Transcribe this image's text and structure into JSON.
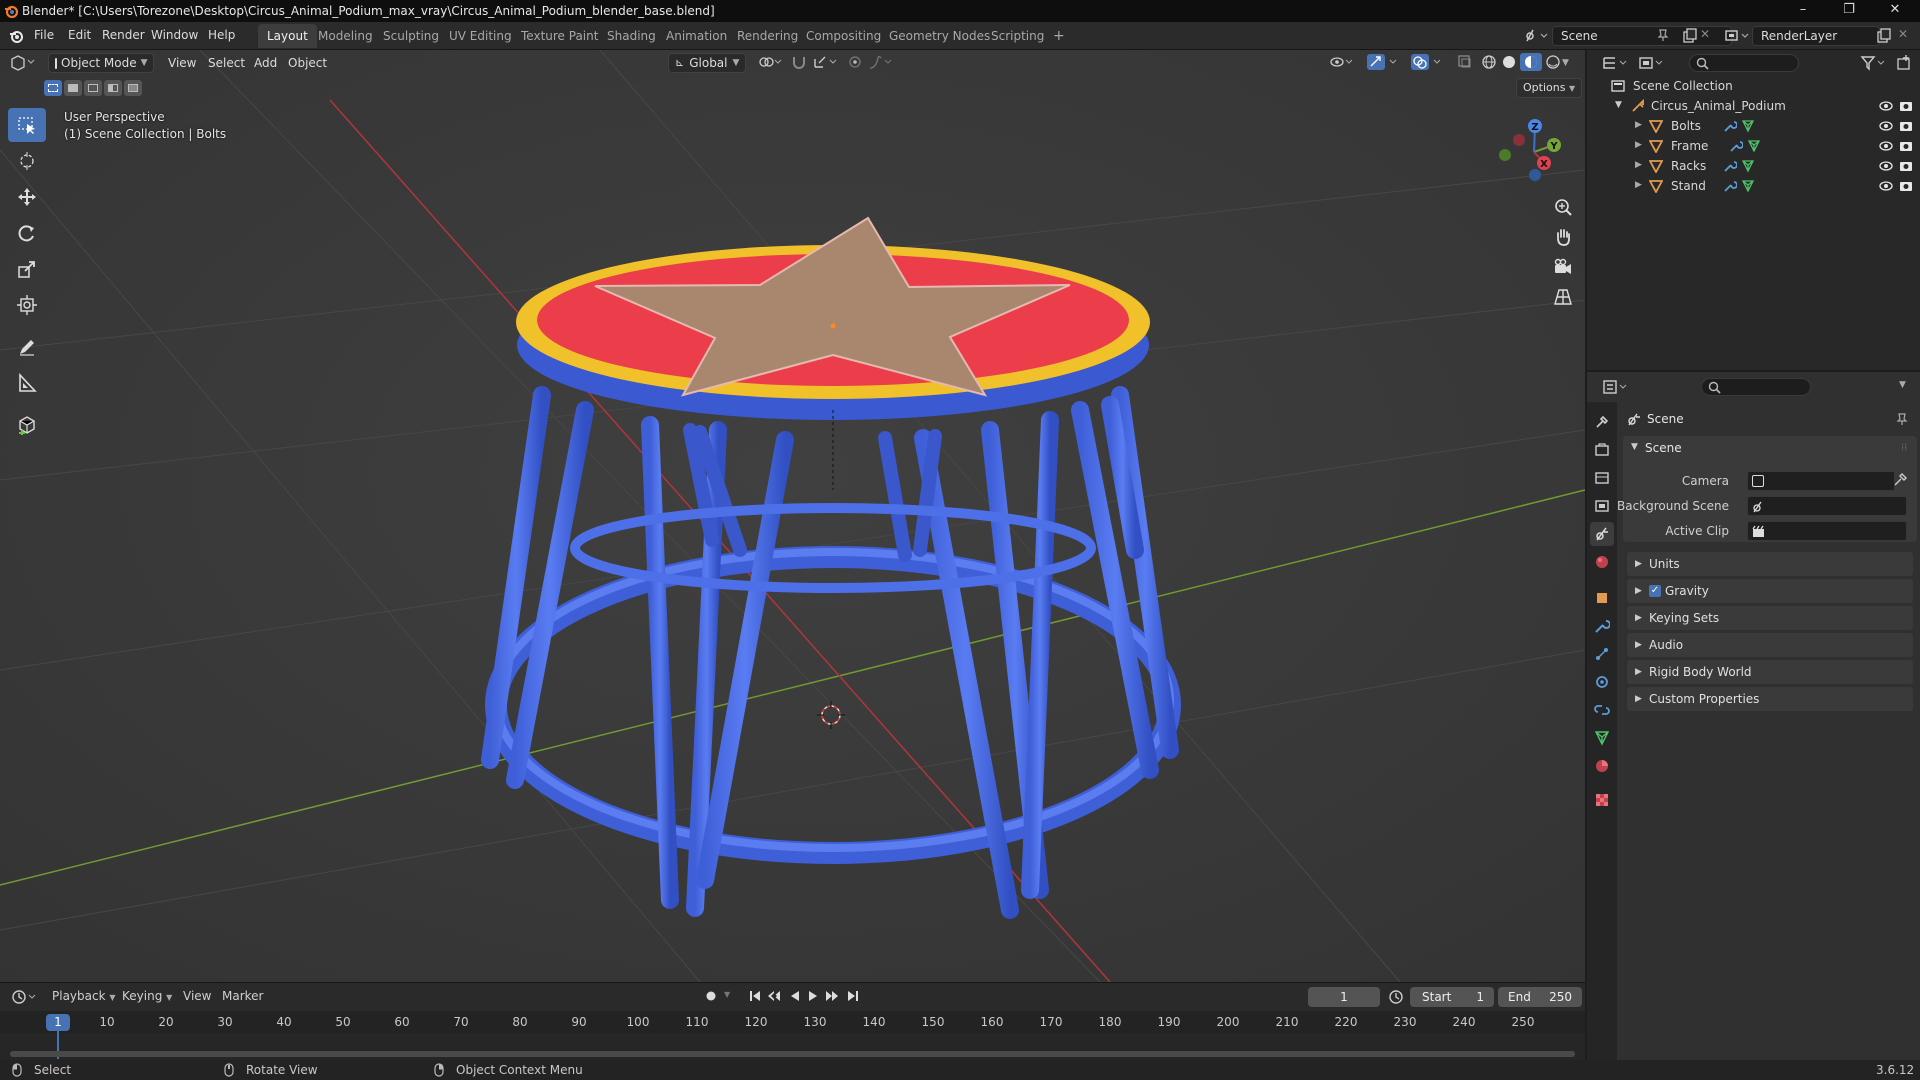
{
  "window": {
    "title": "Blender* [C:\\Users\\Torezone\\Desktop\\Circus_Animal_Podium_max_vray\\Circus_Animal_Podium_blender_base.blend]",
    "minimize": "–",
    "maximize": "❐",
    "close": "✕"
  },
  "menu": [
    "File",
    "Edit",
    "Render",
    "Window",
    "Help"
  ],
  "workspaces": [
    "Layout",
    "Modeling",
    "Sculpting",
    "UV Editing",
    "Texture Paint",
    "Shading",
    "Animation",
    "Rendering",
    "Compositing",
    "Geometry Nodes",
    "Scripting"
  ],
  "workspace_add": "+",
  "scene_field": "Scene",
  "viewlayer_field": "RenderLayer",
  "viewport": {
    "mode": "Object Mode",
    "menus": [
      "View",
      "Select",
      "Add",
      "Object"
    ],
    "orientation": "Global",
    "options": "Options",
    "perspective": "User Perspective",
    "collection_info": "(1) Scene Collection | Bolts"
  },
  "gizmo": {
    "x": "X",
    "y": "Y",
    "z": "Z"
  },
  "outliner": {
    "root": "Scene Collection",
    "collection": "Circus_Animal_Podium",
    "objects": [
      "Bolts",
      "Frame",
      "Racks",
      "Stand"
    ]
  },
  "properties": {
    "header": "Scene",
    "panel": "Scene",
    "fields": [
      {
        "label": "Camera"
      },
      {
        "label": "Background Scene"
      },
      {
        "label": "Active Clip"
      }
    ],
    "sections": [
      "Units",
      "Gravity",
      "Keying Sets",
      "Audio",
      "Rigid Body World",
      "Custom Properties"
    ],
    "gravity_checked": true
  },
  "timeline": {
    "menus": [
      "Playback",
      "Keying",
      "View",
      "Marker"
    ],
    "current_frame": "1",
    "start_label": "Start",
    "start": "1",
    "end_label": "End",
    "end": "250",
    "ticks": [
      "10",
      "20",
      "30",
      "40",
      "50",
      "60",
      "70",
      "80",
      "90",
      "100",
      "110",
      "120",
      "130",
      "140",
      "150",
      "160",
      "170",
      "180",
      "190",
      "200",
      "210",
      "220",
      "230",
      "240",
      "250"
    ],
    "playhead": "1"
  },
  "status": {
    "select": "Select",
    "rotate": "Rotate View",
    "context": "Object Context Menu",
    "version": "3.6.12"
  }
}
